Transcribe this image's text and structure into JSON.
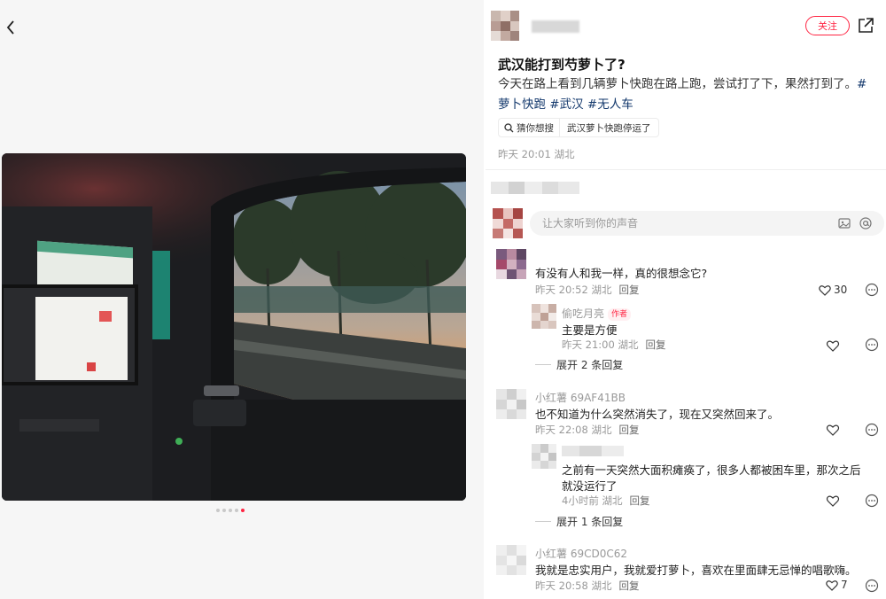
{
  "post": {
    "follow_label": "关注",
    "title": "武汉能打到芍萝卜了?",
    "desc_text": "今天在路上看到几辆萝卜快跑在路上跑，尝试打了下，果然打到了。",
    "tags": [
      "#萝卜快跑",
      "#武汉",
      "#无人车"
    ],
    "search_lead": "猜你想搜",
    "search_query": "武汉萝卜快跑停运了",
    "meta": "昨天 20:01 湖北"
  },
  "comment_box": {
    "placeholder": "让大家听到你的声音"
  },
  "comments": [
    {
      "text": "有没有人和我一样，真的很想念它?",
      "meta": "昨天 20:52 湖北",
      "reply_label": "回复",
      "likes": "30",
      "replies": [
        {
          "name": "偷吃月亮",
          "badge": "作者",
          "text": "主要是方便",
          "meta": "昨天 21:00 湖北",
          "reply_label": "回复"
        }
      ],
      "expand_label": "展开 2 条回复"
    },
    {
      "name": "小红薯 69AF41BB",
      "text": "也不知道为什么突然消失了，现在又突然回来了。",
      "meta": "昨天 22:08 湖北",
      "reply_label": "回复",
      "replies": [
        {
          "text": "之前有一天突然大面积瘫痪了，很多人都被困车里，那次之后",
          "text2": "就没运行了",
          "meta": "4小时前 湖北",
          "reply_label": "回复"
        }
      ],
      "expand_label": "展开 1 条回复"
    },
    {
      "name": "小红薯 69CD0C62",
      "text": "我就是忠实用户，我就爱打萝卜，喜欢在里面肆无忌惮的唱歌嗨。",
      "meta": "昨天 20:58 湖北",
      "reply_label": "回复",
      "likes": "7"
    }
  ],
  "colors": {
    "accent": "#ff2442",
    "tag": "#13386c",
    "muted": "#999999"
  },
  "icons": [
    "back-arrow-icon",
    "share-icon",
    "search-icon",
    "image-icon",
    "at-icon",
    "heart-icon",
    "more-icon"
  ],
  "carousel": {
    "count": 5,
    "active_index": 4
  }
}
